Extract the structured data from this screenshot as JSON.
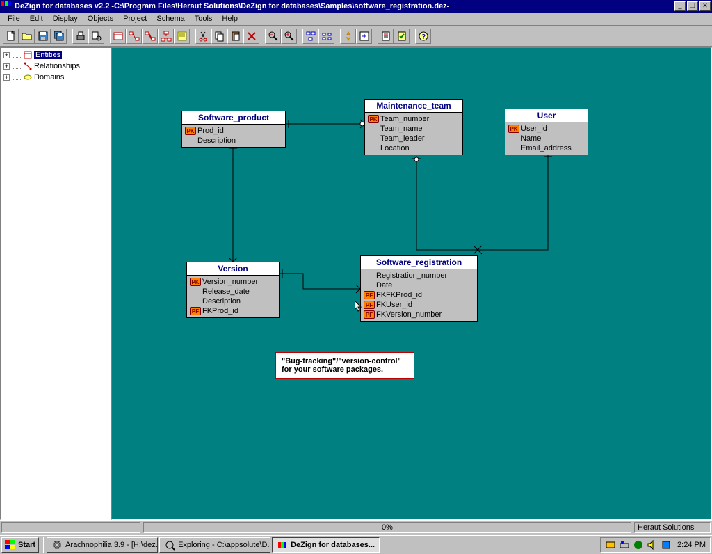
{
  "window": {
    "title": "DeZign for databases v2.2 -C:\\Program Files\\Heraut Solutions\\DeZign for databases\\Samples\\software_registration.dez-",
    "min": "_",
    "max": "❐",
    "close": "✕"
  },
  "menu": [
    "File",
    "Edit",
    "Display",
    "Objects",
    "Project",
    "Schema",
    "Tools",
    "Help"
  ],
  "tree": {
    "n0": "Entities",
    "n1": "Relationships",
    "n2": "Domains"
  },
  "entities": {
    "software_product": {
      "title": "Software_product",
      "a0": "Prod_id",
      "a1": "Description"
    },
    "maintenance_team": {
      "title": "Maintenance_team",
      "a0": "Team_number",
      "a1": "Team_name",
      "a2": "Team_leader",
      "a3": "Location"
    },
    "user": {
      "title": "User",
      "a0": "User_id",
      "a1": "Name",
      "a2": "Email_address"
    },
    "version": {
      "title": "Version",
      "a0": "Version_number",
      "a1": "Release_date",
      "a2": "Description",
      "a3": "FKProd_id"
    },
    "software_registration": {
      "title": "Software_registration",
      "a0": "Registration_number",
      "a1": "Date",
      "a2": "FKFKProd_id",
      "a3": "FKUser_id",
      "a4": "FKVersion_number"
    }
  },
  "note": "\"Bug-tracking\"/\"version-control\" for your software packages.",
  "status": {
    "progress": "0%",
    "vendor": "Heraut Solutions"
  },
  "taskbar": {
    "start": "Start",
    "t0": "Arachnophilia 3.9 - [H:\\dez...",
    "t1": "Exploring - C:\\appsolute\\D...",
    "t2": "DeZign for databases...",
    "clock": "2:24 PM"
  },
  "keys": {
    "pk": "PK",
    "fk": "PF"
  }
}
